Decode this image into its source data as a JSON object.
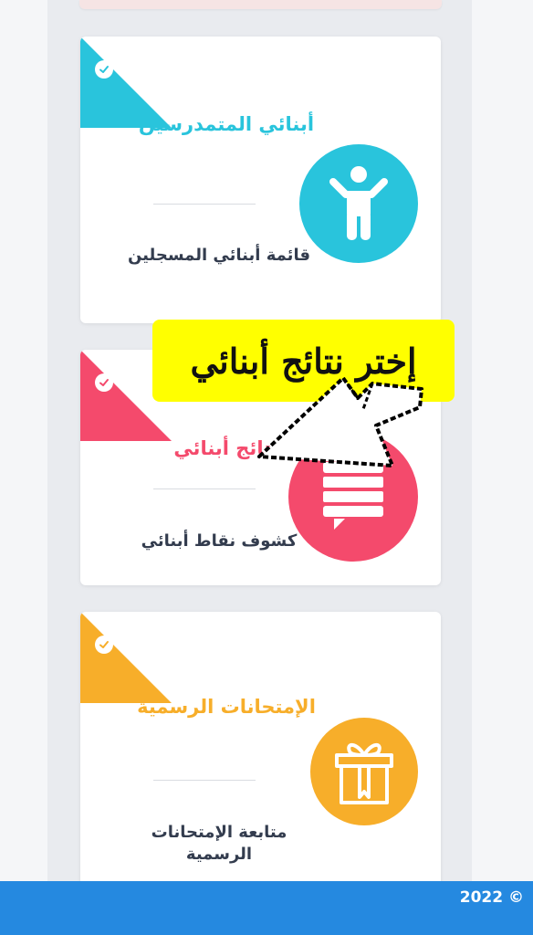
{
  "cards": [
    {
      "title": "أبنائي المتمدرسين",
      "description": "قائمة أبنائي المسجلين",
      "accent": "#29c4dc",
      "icon": "child-icon"
    },
    {
      "title": "نتائج أبنائي",
      "description": "كشوف نقاط أبنائي",
      "accent": "#f44a6c",
      "icon": "message-list-icon"
    },
    {
      "title": "الإمتحانات الرسمية",
      "description": "متابعة الإمتحانات الرسمية",
      "accent": "#f7ae2a",
      "icon": "gift-icon"
    }
  ],
  "callout": {
    "text": "إختر نتائج أبنائي",
    "color": "#ffff00"
  },
  "footer": {
    "text": "2022 ©",
    "color": "#2589e0"
  }
}
